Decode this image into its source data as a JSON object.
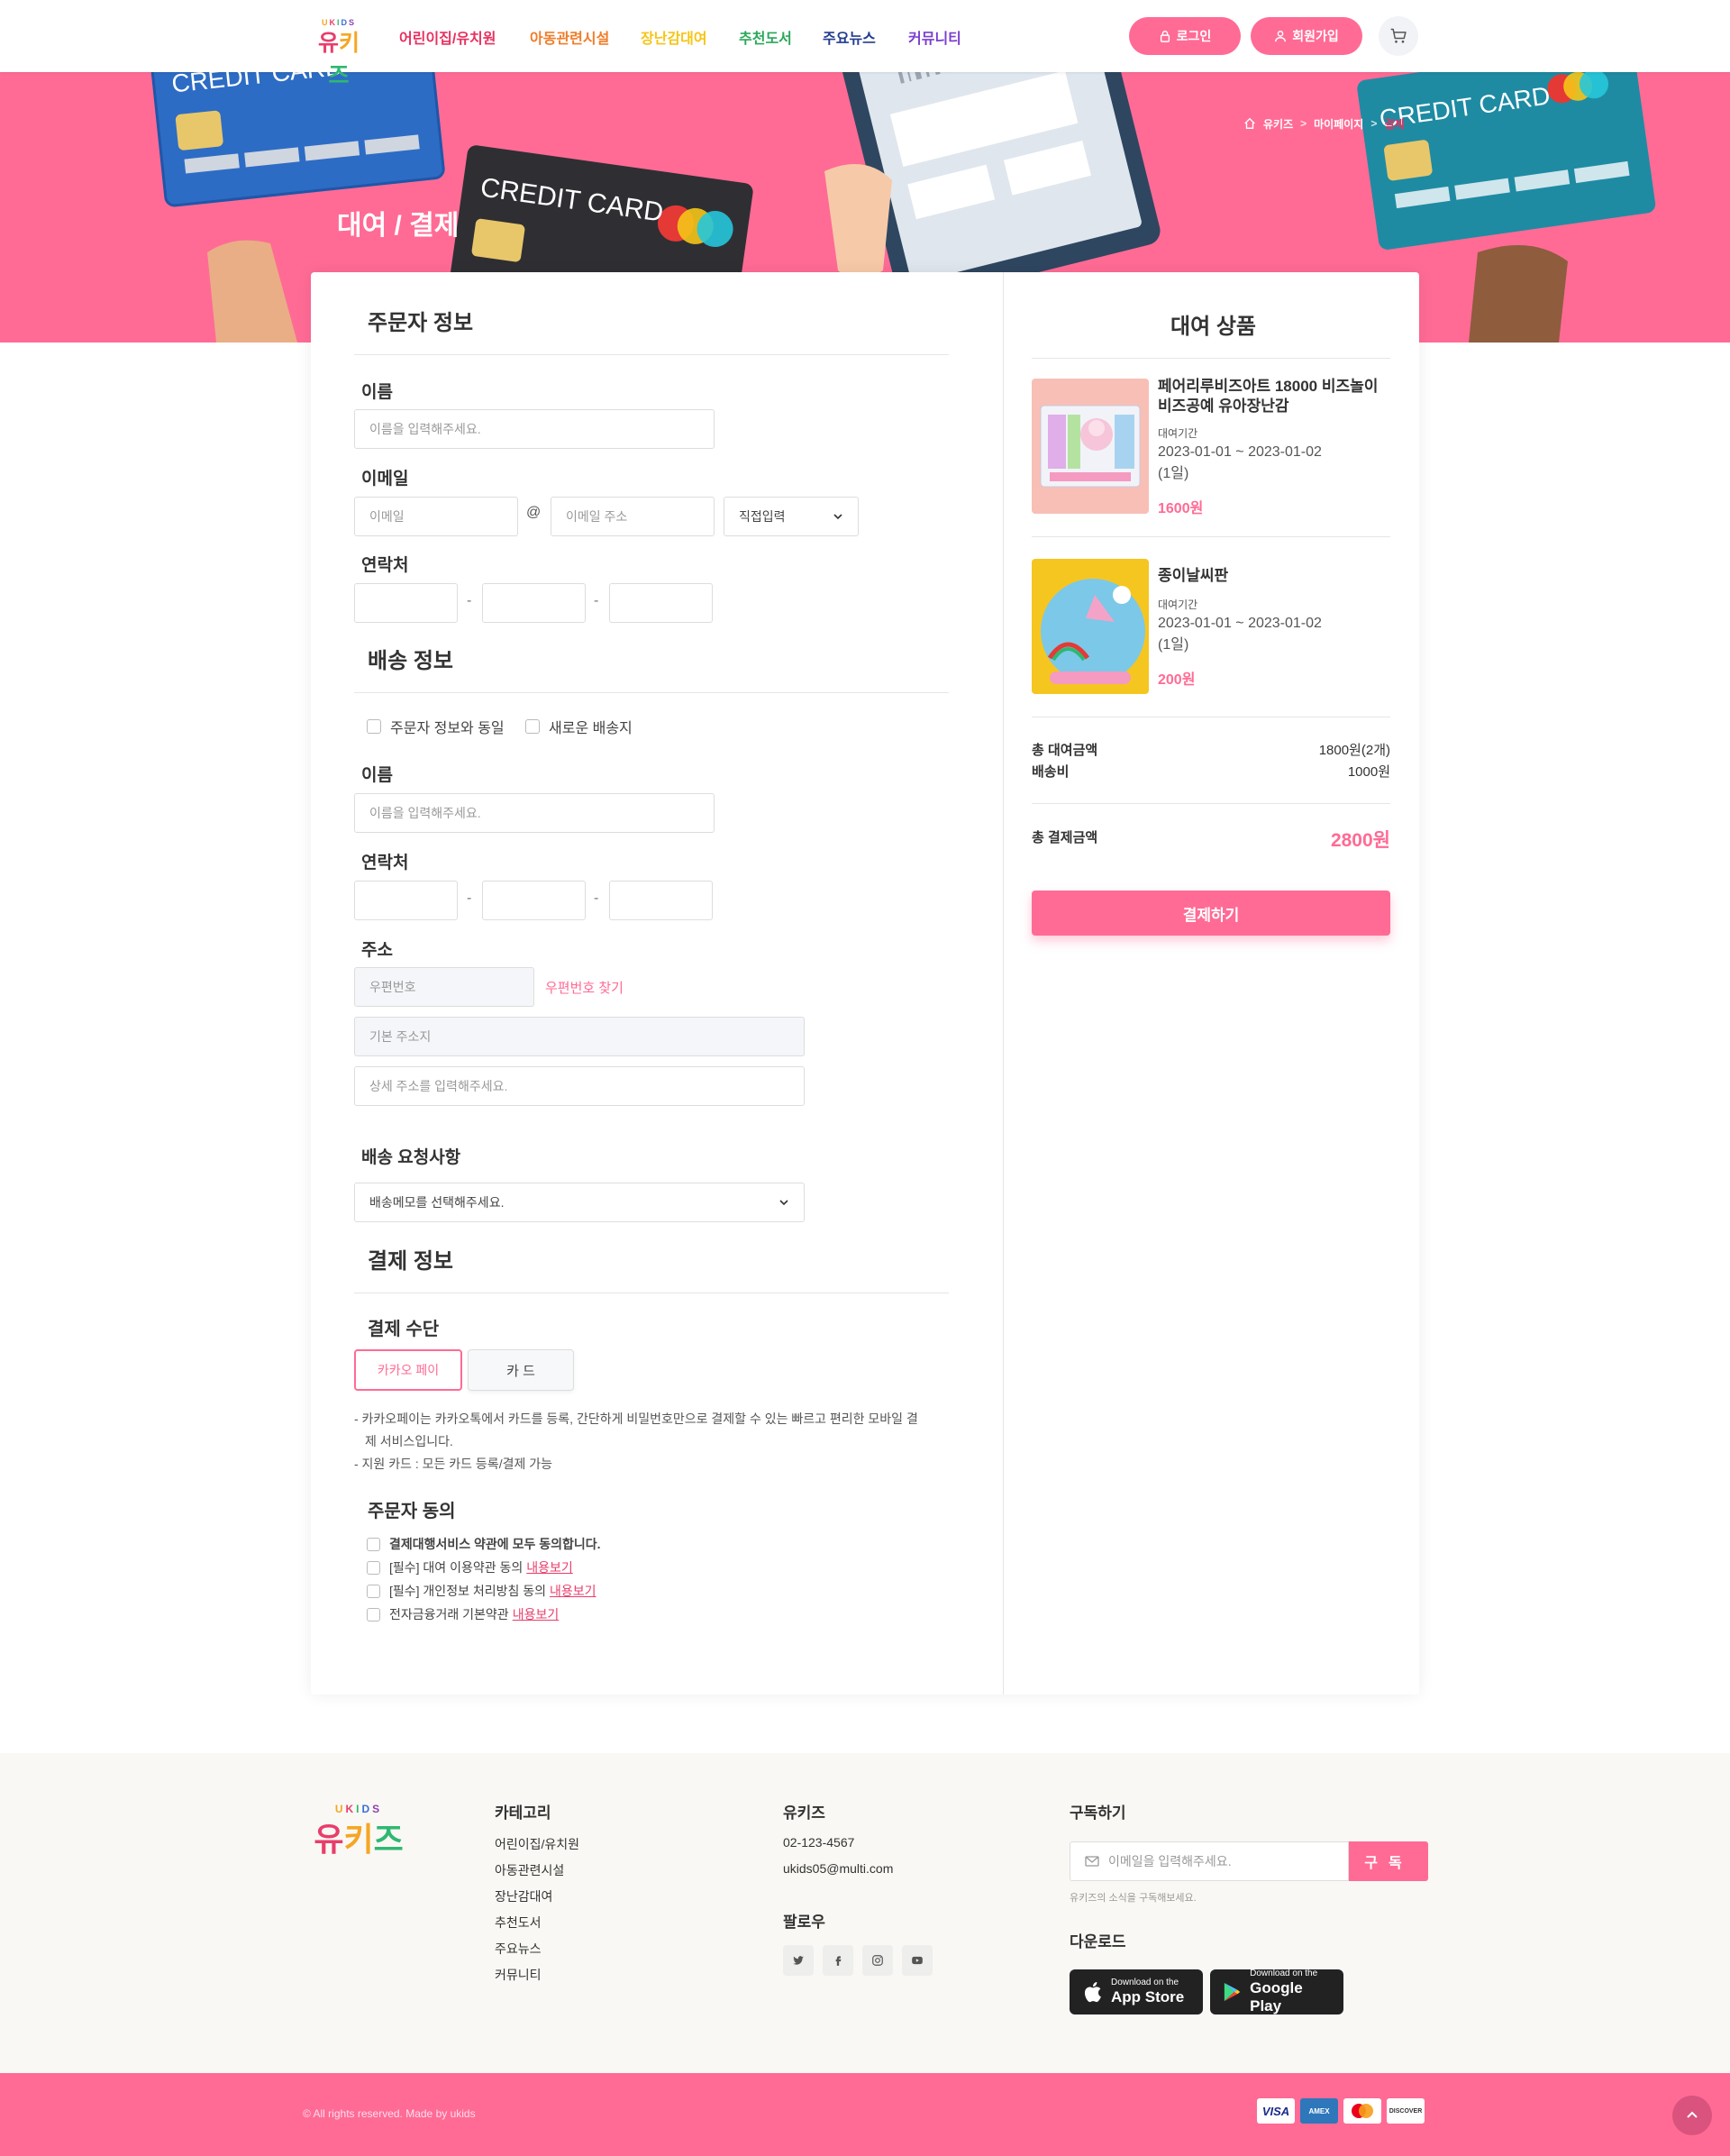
{
  "header": {
    "logo_small": [
      "U",
      "K",
      "I",
      "D",
      "S"
    ],
    "logo_main": [
      "유",
      "키",
      "즈"
    ],
    "nav": [
      {
        "label": "어린이집/유치원",
        "color": "#e8305f"
      },
      {
        "label": "아동관련시설",
        "color": "#f07d2a"
      },
      {
        "label": "장난감대여",
        "color": "#f5c518"
      },
      {
        "label": "추천도서",
        "color": "#2aa85a"
      },
      {
        "label": "주요뉴스",
        "color": "#243c8f"
      },
      {
        "label": "커뮤니티",
        "color": "#7a3fd0"
      }
    ],
    "login_label": "로그인",
    "signup_label": "회원가입",
    "cart_icon": "cart-icon"
  },
  "hero": {
    "title": "대여 / 결제",
    "breadcrumb": [
      "유키즈",
      "마이페이지",
      "결제"
    ],
    "card_text": "CREDIT CARD"
  },
  "orderer": {
    "title": "주문자 정보",
    "name_label": "이름",
    "name_placeholder": "이름을 입력해주세요.",
    "email_label": "이메일",
    "email_id_placeholder": "이메일",
    "email_at": "@",
    "email_domain_placeholder": "이메일 주소",
    "email_select": "직접입력",
    "phone_label": "연락처",
    "dash": "-"
  },
  "shipping": {
    "title": "배송 정보",
    "same_as_orderer": "주문자 정보와 동일",
    "new_address": "새로운 배송지",
    "name_label": "이름",
    "name_placeholder": "이름을 입력해주세요.",
    "phone_label": "연락처",
    "address_label": "주소",
    "zip_placeholder": "우편번호",
    "zip_search": "우편번호 찾기",
    "addr1_placeholder": "기본 주소지",
    "addr2_placeholder": "상세 주소를 입력해주세요.",
    "request_label": "배송 요청사항",
    "request_select": "배송메모를 선택해주세요."
  },
  "payment": {
    "title": "결제 정보",
    "method_label": "결제 수단",
    "kakao": "카카오 페이",
    "card": "카 드",
    "note1": "- 카카오페이는 카카오톡에서 카드를 등록, 간단하게 비밀번호만으로 결제할 수 있는 빠르고 편리한 모바일 결",
    "note2": "제 서비스입니다.",
    "note3": "- 지원 카드 : 모든 카드 등록/결제 가능",
    "agree_title": "주문자 동의",
    "agree_all": "결제대행서비스 약관에 모두 동의합니다.",
    "agree1": "[필수] 대여 이용약관 동의",
    "agree2": "[필수] 개인정보 처리방침 동의",
    "agree3": "전자금융거래 기본약관",
    "view_link": "내용보기"
  },
  "cart": {
    "title": "대여 상품",
    "period_label": "대여기간",
    "items": [
      {
        "name_line1": "페어리루비즈아트 18000 비즈놀이",
        "name_line2": "비즈공예 유아장난감",
        "date": "2023-01-01 ~ 2023-01-02",
        "days": "(1일)",
        "price": "1600원"
      },
      {
        "name_line1": "종이날씨판",
        "name_line2": "",
        "date": "2023-01-01 ~ 2023-01-02",
        "days": "(1일)",
        "price": "200원"
      }
    ],
    "total_rental_label": "총 대여금액",
    "total_rental_value": "1800원(2개)",
    "shipping_label": "배송비",
    "shipping_value": "1000원",
    "total_pay_label": "총 결제금액",
    "total_pay_value": "2800원",
    "pay_button": "결제하기"
  },
  "footer": {
    "category_title": "카테고리",
    "categories": [
      "어린이집/유치원",
      "아동관련시설",
      "장난감대여",
      "추천도서",
      "주요뉴스",
      "커뮤니티"
    ],
    "company_title": "유키즈",
    "phone": "02-123-4567",
    "email": "ukids05@multi.com",
    "follow_title": "팔로우",
    "subscribe_title": "구독하기",
    "subscribe_placeholder": "이메일을 입력해주세요.",
    "subscribe_button": "구독",
    "subscribe_note": "유키즈의 소식을 구독해보세요.",
    "download_title": "다운로드",
    "appstore_small": "Download on the",
    "appstore_big": "App Store",
    "googleplay_small": "Download on the",
    "googleplay_big": "Google Play",
    "copyright": "© All rights reserved. Made by ukids",
    "cards": [
      "VISA",
      "AMEX",
      "MC",
      "DISCOVER"
    ]
  },
  "colors": {
    "accent": "#ff6b95",
    "accent_dark": "#e8305f",
    "footer_bg": "#f9f8f4"
  }
}
